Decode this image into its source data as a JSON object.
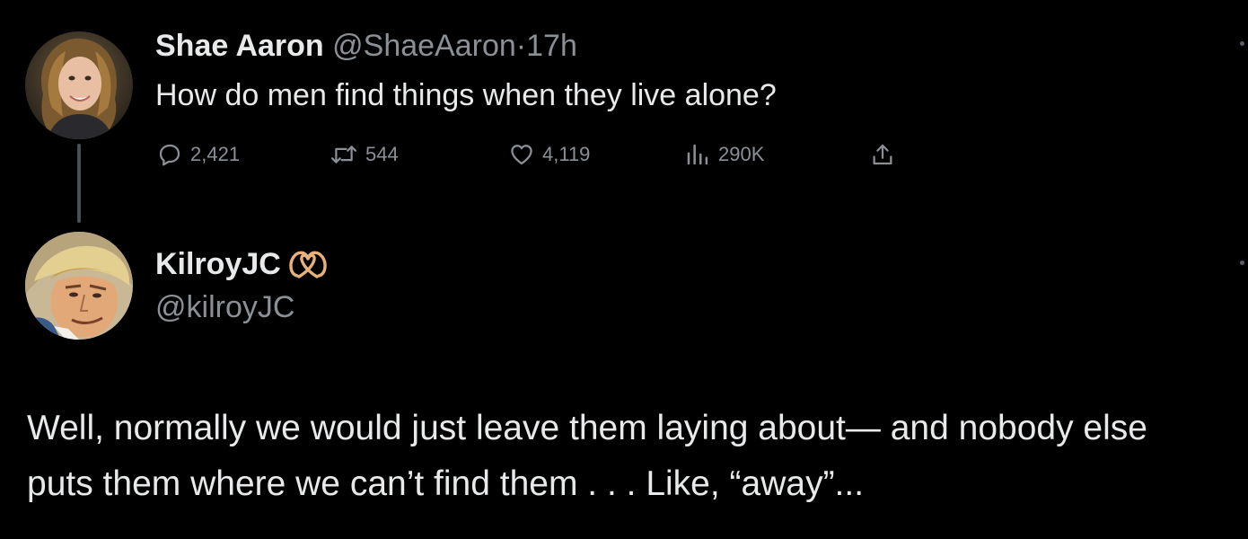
{
  "tweet1": {
    "display_name": "Shae Aaron",
    "handle": "@ShaeAaron",
    "separator": "·",
    "time": "17h",
    "text": "How do men find things when they live alone?",
    "actions": {
      "replies": "2,421",
      "retweets": "544",
      "likes": "4,119",
      "views": "290K"
    }
  },
  "tweet2": {
    "display_name": "KilroyJC",
    "badge_icon": "pretzel-icon",
    "handle": "@kilroyJC",
    "text_lines": [
      "Well, normally we would just leave them laying about— and nobody else",
      "puts them where we can’t find them . . . Like, “away”..."
    ]
  },
  "icons": {
    "reply": "reply-icon",
    "retweet": "retweet-icon",
    "like": "heart-icon",
    "views": "views-icon",
    "share": "share-icon"
  },
  "colors": {
    "background": "#000000",
    "primary_text": "#e7e9ea",
    "secondary_text": "#8b9096",
    "badge": "#e8b07a"
  }
}
